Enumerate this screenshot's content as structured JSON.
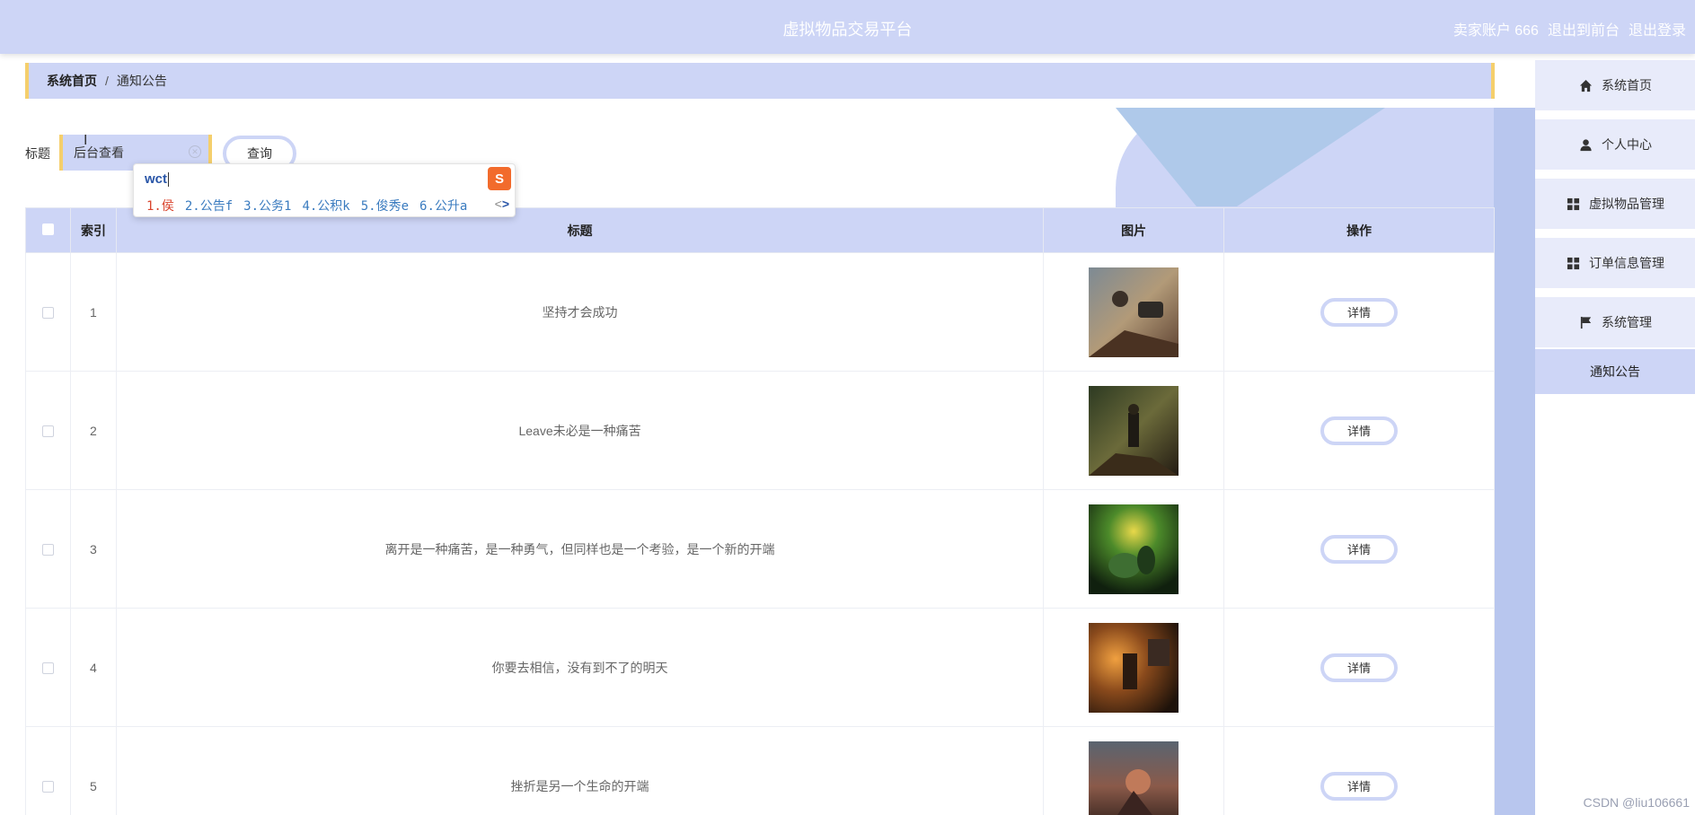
{
  "header": {
    "title": "虚拟物品交易平台",
    "account": "卖家账户 666",
    "back_to_front": "退出到前台",
    "logout": "退出登录"
  },
  "breadcrumb": {
    "home": "系统首页",
    "separator": "/",
    "current": "通知公告"
  },
  "search": {
    "label": "标题",
    "value": "后台查看",
    "query_button": "查询"
  },
  "ime": {
    "composition": "wct",
    "candidates": [
      "1.侯",
      "2.公告f",
      "3.公务1",
      "4.公积k",
      "5.俊秀e",
      "6.公升a"
    ],
    "prev": "<",
    "next": ">"
  },
  "sidebar": {
    "items": [
      {
        "label": "系统首页",
        "icon": "home-icon"
      },
      {
        "label": "个人中心",
        "icon": "user-icon"
      },
      {
        "label": "虚拟物品管理",
        "icon": "grid-icon"
      },
      {
        "label": "订单信息管理",
        "icon": "grid-icon"
      },
      {
        "label": "系统管理",
        "icon": "flag-icon"
      }
    ],
    "active_sub": "通知公告"
  },
  "table": {
    "headers": [
      "索引",
      "标题",
      "图片",
      "操作"
    ],
    "detail_label": "详情",
    "rows": [
      {
        "index": "1",
        "title": "坚持才会成功"
      },
      {
        "index": "2",
        "title": "Leave未必是一种痛苦"
      },
      {
        "index": "3",
        "title": "离开是一种痛苦，是一种勇气，但同样也是一个考验，是一个新的开端"
      },
      {
        "index": "4",
        "title": "你要去相信，没有到不了的明天"
      },
      {
        "index": "5",
        "title": "挫折是另一个生命的开端"
      }
    ]
  },
  "watermark": "CSDN @liu106661",
  "colors": {
    "primary": "#cdd5f6",
    "accent": "#f5cf6c",
    "ime_logo": "#f26b2c"
  }
}
